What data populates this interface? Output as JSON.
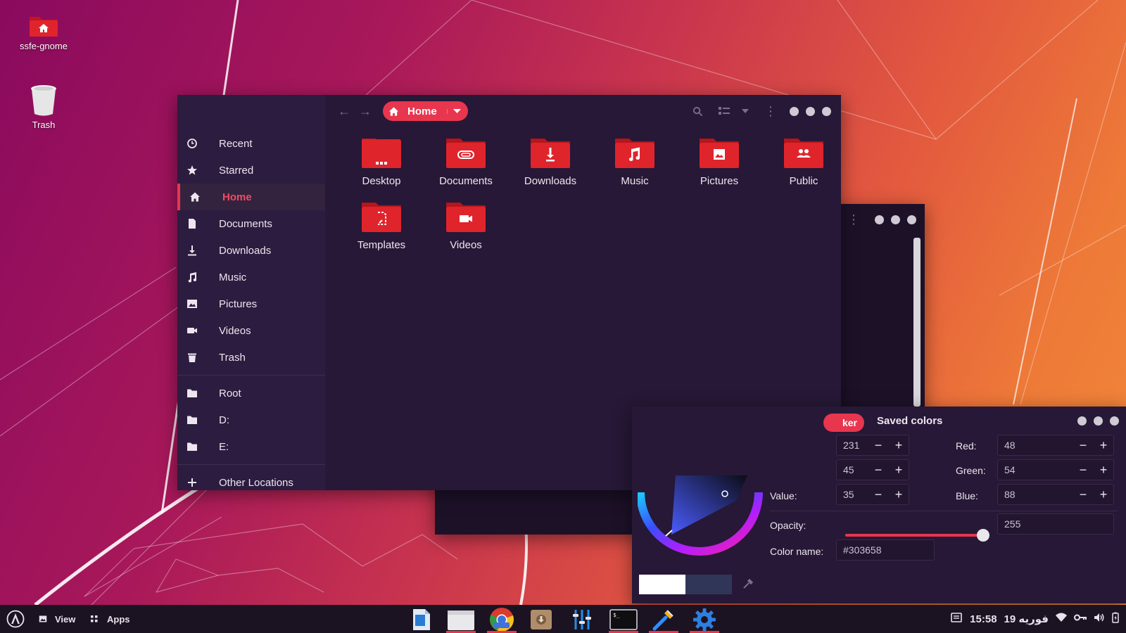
{
  "desktop": {
    "icons": [
      {
        "label": "ssfe-gnome",
        "icon": "home-folder-icon"
      },
      {
        "label": "Trash",
        "icon": "trash-can-icon"
      }
    ]
  },
  "file_manager": {
    "sidebar": {
      "items": [
        {
          "label": "Recent",
          "icon": "clock-icon"
        },
        {
          "label": "Starred",
          "icon": "star-icon"
        },
        {
          "label": "Home",
          "icon": "home-icon",
          "active": true
        },
        {
          "label": "Documents",
          "icon": "document-icon"
        },
        {
          "label": "Downloads",
          "icon": "download-icon"
        },
        {
          "label": "Music",
          "icon": "music-note-icon"
        },
        {
          "label": "Pictures",
          "icon": "picture-icon"
        },
        {
          "label": "Videos",
          "icon": "video-camera-icon"
        },
        {
          "label": "Trash",
          "icon": "trash-icon"
        }
      ],
      "drives": [
        {
          "label": "Root",
          "icon": "folder-icon"
        },
        {
          "label": "D:",
          "icon": "folder-icon"
        },
        {
          "label": "E:",
          "icon": "folder-icon"
        }
      ],
      "other_locations": {
        "label": "Other Locations",
        "icon": "plus-icon"
      }
    },
    "path": {
      "label": "Home",
      "icon": "home-icon"
    },
    "folders": [
      {
        "label": "Desktop",
        "icon": "ellipsis-icon"
      },
      {
        "label": "Documents",
        "icon": "paperclip-icon"
      },
      {
        "label": "Downloads",
        "icon": "download-arrow-icon"
      },
      {
        "label": "Music",
        "icon": "music-note-icon"
      },
      {
        "label": "Pictures",
        "icon": "picture-icon"
      },
      {
        "label": "Public",
        "icon": "people-icon"
      },
      {
        "label": "Templates",
        "icon": "template-icon"
      },
      {
        "label": "Videos",
        "icon": "video-camera-icon"
      }
    ]
  },
  "color_picker": {
    "tabs": {
      "active_fragment": "ker",
      "saved": "Saved colors"
    },
    "hue_value": "231",
    "saturation_value": "45",
    "value_label": "Value:",
    "value_value": "35",
    "red_label": "Red:",
    "red_value": "48",
    "green_label": "Green:",
    "green_value": "54",
    "blue_label": "Blue:",
    "blue_value": "88",
    "opacity_label": "Opacity:",
    "opacity_value": "255",
    "opacity_fraction": 1.0,
    "color_name_label": "Color name:",
    "color_name_value": "#303658",
    "current_color": "#303658",
    "previous_color": "#ffffff"
  },
  "taskbar": {
    "view_label": "View",
    "apps_label": "Apps",
    "clock": "15:58",
    "date": "فوریه 19",
    "pinned_apps": [
      {
        "name": "writer-app-icon",
        "running": false
      },
      {
        "name": "files-app-icon",
        "running": true
      },
      {
        "name": "chrome-beta-app-icon",
        "running": true
      },
      {
        "name": "archive-manager-app-icon",
        "running": false
      },
      {
        "name": "mixer-app-icon",
        "running": false
      },
      {
        "name": "terminal-app-icon",
        "running": true
      },
      {
        "name": "color-picker-app-icon",
        "running": true
      },
      {
        "name": "settings-app-icon",
        "running": true
      }
    ]
  },
  "colors": {
    "accent": "#e8364f",
    "window_bg": "#261836",
    "sidebar_bg": "#2c1c3f",
    "taskbar_bg": "#1c1322"
  }
}
